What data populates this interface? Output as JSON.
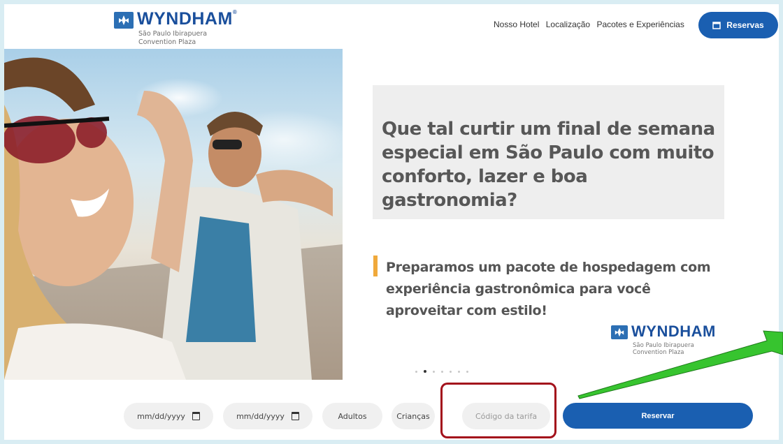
{
  "brand": {
    "name": "WYNDHAM",
    "registered": "®",
    "subtitle_line1": "São Paulo Ibirapuera",
    "subtitle_line2": "Convention Plaza"
  },
  "nav": {
    "items": [
      "Nosso Hotel",
      "Localização",
      "Pacotes e Experiências"
    ],
    "reservas_button": "Reservas"
  },
  "hero": {
    "headline": "Que tal curtir um final de semana especial em São Paulo com muito conforto, lazer e boa gastronomia?",
    "subheadline": "Preparamos um pacote de hospedagem com experiência gastronômica para você aproveitar com estilo!"
  },
  "carousel": {
    "dot_count": 7,
    "active_index": 1
  },
  "booking": {
    "checkin_placeholder": "mm/dd/yyyy",
    "checkout_placeholder": "mm/dd/yyyy",
    "adultos": "Adultos",
    "criancas": "Crianças",
    "codigo_placeholder": "Código da tarifa",
    "submit": "Reservar"
  },
  "colors": {
    "brand_blue": "#1a5fb1",
    "accent_orange": "#f0a93b",
    "highlight_red": "#a3111b",
    "arrow_green": "#37c42f"
  }
}
